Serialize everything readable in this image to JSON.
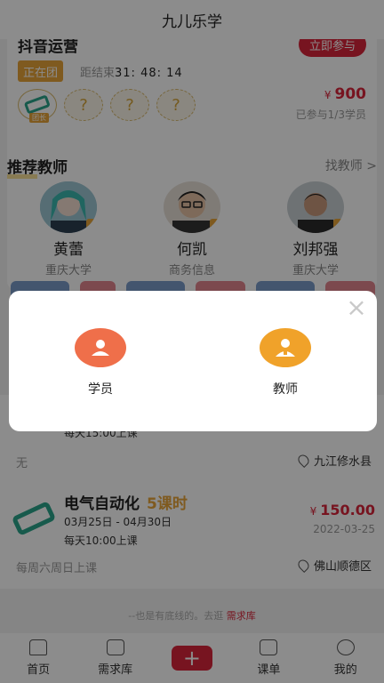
{
  "app": {
    "title": "九儿乐学"
  },
  "group_buy": {
    "title": "抖音运营",
    "join_label": "立即参与",
    "status": "正在团",
    "countdown_prefix": "距结束",
    "countdown": "31: 48: 14",
    "slot_placeholder": "?",
    "slot_tag": "团长",
    "price_symbol": "¥",
    "price": "900",
    "progress": "已参与1/3学员"
  },
  "teachers": {
    "title": "推荐教师",
    "find_label": "找教师",
    "chevron": ">",
    "items": [
      {
        "name": "黄蕾",
        "school": "重庆大学"
      },
      {
        "name": "何凯",
        "school": "商务信息"
      },
      {
        "name": "刘邦强",
        "school": "重庆大学"
      }
    ]
  },
  "courses": [
    {
      "time": "每天15:00上课",
      "note": "无",
      "location": "九江修水县"
    },
    {
      "title": "电气自动化",
      "lessons": "5课时",
      "dates": "03月25日 - 04月30日",
      "time": "每天10:00上课",
      "price_symbol": "¥",
      "price": "150.00",
      "date": "2022-03-25",
      "note": "每周六周日上课",
      "location": "佛山顺德区"
    }
  ],
  "footer": {
    "hint_text": "--也是有底线的。去逛",
    "hint_link": "需求库"
  },
  "tabbar": {
    "items": [
      {
        "label": "首页"
      },
      {
        "label": "需求库"
      },
      {
        "label": "+"
      },
      {
        "label": "课单"
      },
      {
        "label": "我的"
      }
    ]
  },
  "dialog": {
    "close": "×",
    "options": [
      {
        "label": "学员",
        "color": "#ef6f4a"
      },
      {
        "label": "教师",
        "color": "#f0a22a"
      }
    ]
  },
  "colors": {
    "brand_red": "#d9263b",
    "accent_orange": "#e8a53a"
  }
}
